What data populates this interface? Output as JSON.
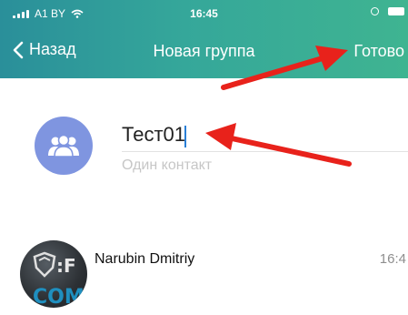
{
  "status_bar": {
    "carrier": "A1 BY",
    "time": "16:45"
  },
  "nav": {
    "back_label": "Назад",
    "title": "Новая группа",
    "done_label": "Готово"
  },
  "group": {
    "name_value": "Тест01",
    "member_count": "Один контакт"
  },
  "contacts": [
    {
      "name": "Narubin Dmitriy",
      "time": "16:4",
      "avatar_text": ":F",
      "avatar_text2": "COM"
    }
  ],
  "colors": {
    "header_start": "#2a8f9a",
    "header_end": "#3fb491",
    "group_avatar": "#7f95e0",
    "annotation_arrow": "#e8221b"
  },
  "icons": {
    "back": "chevron-left-icon",
    "group_avatar": "people-group-icon"
  }
}
